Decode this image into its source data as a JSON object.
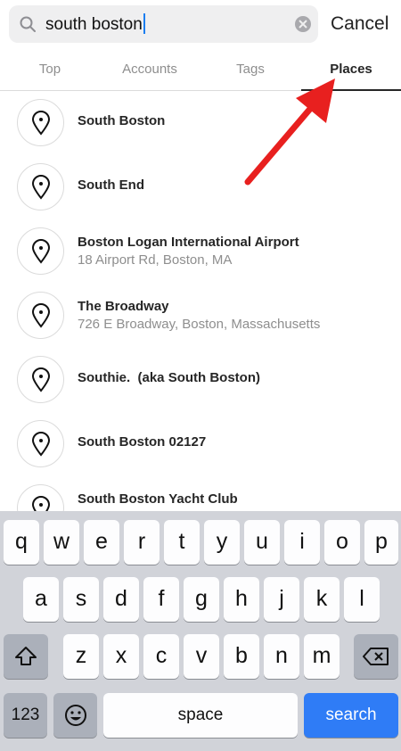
{
  "search": {
    "query": "south boston",
    "cancel_label": "Cancel"
  },
  "tabs": [
    {
      "label": "Top",
      "active": false
    },
    {
      "label": "Accounts",
      "active": false
    },
    {
      "label": "Tags",
      "active": false
    },
    {
      "label": "Places",
      "active": true
    }
  ],
  "results": [
    {
      "title": "South Boston",
      "subtitle": ""
    },
    {
      "title": "South End",
      "subtitle": ""
    },
    {
      "title": "Boston Logan International Airport",
      "subtitle": "18 Airport Rd, Boston, MA"
    },
    {
      "title": "The Broadway",
      "subtitle": "726 E Broadway, Boston, Massachusetts"
    },
    {
      "title": "Southie.  (aka South Boston)",
      "subtitle": ""
    },
    {
      "title": "South Boston 02127",
      "subtitle": ""
    },
    {
      "title": "South Boston Yacht Club",
      "subtitle": ""
    }
  ],
  "keyboard": {
    "row1": [
      "q",
      "w",
      "e",
      "r",
      "t",
      "y",
      "u",
      "i",
      "o",
      "p"
    ],
    "row2": [
      "a",
      "s",
      "d",
      "f",
      "g",
      "h",
      "j",
      "k",
      "l"
    ],
    "row3": [
      "z",
      "x",
      "c",
      "v",
      "b",
      "n",
      "m"
    ],
    "numbers_label": "123",
    "emoji_icon": "emoji-icon",
    "space_label": "space",
    "search_label": "search",
    "shift_icon": "shift-icon",
    "delete_icon": "backspace-icon"
  },
  "annotation": {
    "arrow_color": "#e8201f",
    "icon": "red-arrow-icon"
  },
  "colors": {
    "accent_blue": "#2f7cf6",
    "text_primary": "#262626",
    "text_secondary": "#8e8e8e"
  }
}
